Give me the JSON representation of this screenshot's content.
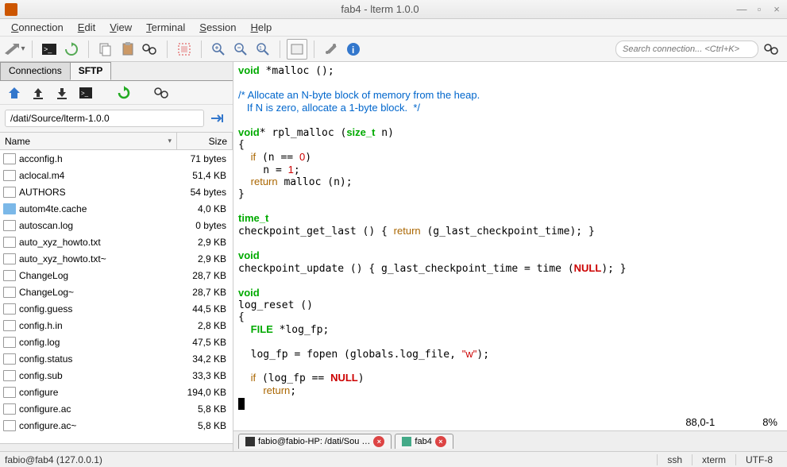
{
  "title": "fab4 - lterm 1.0.0",
  "menu": [
    "Connection",
    "Edit",
    "View",
    "Terminal",
    "Session",
    "Help"
  ],
  "search": {
    "placeholder": "Search connection... <Ctrl+K>"
  },
  "tabs": {
    "conn": "Connections",
    "sftp": "SFTP"
  },
  "path": "/dati/Source/lterm-1.0.0",
  "cols": {
    "name": "Name",
    "size": "Size"
  },
  "files": [
    {
      "name": "acconfig.h",
      "size": "71 bytes",
      "type": "file"
    },
    {
      "name": "aclocal.m4",
      "size": "51,4 KB",
      "type": "file"
    },
    {
      "name": "AUTHORS",
      "size": "54 bytes",
      "type": "file"
    },
    {
      "name": "autom4te.cache",
      "size": "4,0 KB",
      "type": "folder"
    },
    {
      "name": "autoscan.log",
      "size": "0 bytes",
      "type": "file"
    },
    {
      "name": "auto_xyz_howto.txt",
      "size": "2,9 KB",
      "type": "file"
    },
    {
      "name": "auto_xyz_howto.txt~",
      "size": "2,9 KB",
      "type": "file"
    },
    {
      "name": "ChangeLog",
      "size": "28,7 KB",
      "type": "file"
    },
    {
      "name": "ChangeLog~",
      "size": "28,7 KB",
      "type": "file"
    },
    {
      "name": "config.guess",
      "size": "44,5 KB",
      "type": "file"
    },
    {
      "name": "config.h.in",
      "size": "2,8 KB",
      "type": "file"
    },
    {
      "name": "config.log",
      "size": "47,5 KB",
      "type": "file"
    },
    {
      "name": "config.status",
      "size": "34,2 KB",
      "type": "file"
    },
    {
      "name": "config.sub",
      "size": "33,3 KB",
      "type": "file"
    },
    {
      "name": "configure",
      "size": "194,0 KB",
      "type": "file"
    },
    {
      "name": "configure.ac",
      "size": "5,8 KB",
      "type": "file"
    },
    {
      "name": "configure.ac~",
      "size": "5,8 KB",
      "type": "file"
    }
  ],
  "vim": {
    "pos": "88,0-1",
    "pct": "8%"
  },
  "term_tabs": [
    {
      "label": "fabio@fabio-HP: /dati/Sou …"
    },
    {
      "label": "fab4"
    }
  ],
  "status": {
    "host": "fabio@fab4 (127.0.0.1)",
    "proto": "ssh",
    "term": "xterm",
    "enc": "UTF-8"
  }
}
